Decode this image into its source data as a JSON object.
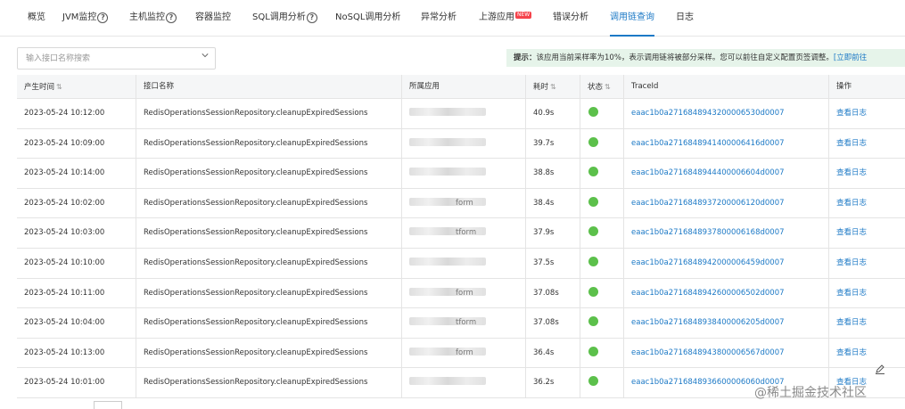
{
  "tabs": [
    {
      "label": "概览"
    },
    {
      "label": "JVM监控"
    },
    {
      "label": "主机监控"
    },
    {
      "label": "容器监控"
    },
    {
      "label": "SQL调用分析"
    },
    {
      "label": "NoSQL调用分析"
    },
    {
      "label": "异常分析"
    },
    {
      "label": "上游应用",
      "badge": "NEW"
    },
    {
      "label": "错误分析"
    },
    {
      "label": "调用链查询"
    },
    {
      "label": "日志"
    }
  ],
  "search": {
    "placeholder": "输入接口名称搜索",
    "value": ""
  },
  "notice": {
    "prefix": "提示：",
    "text": "该应用当前采样率为10%，表示调用链将被部分采样。您可以前往自定义配置页签调整。",
    "link": "[立即前往"
  },
  "table": {
    "columns": {
      "time": "产生时间",
      "api": "接口名称",
      "app": "所属应用",
      "duration": "耗时",
      "status": "状态",
      "trace": "TraceId",
      "op": "操作"
    },
    "rows": [
      {
        "time": "2023-05-24 10:12:00",
        "api": "RedisOperationsSessionRepository.cleanupExpiredSessions",
        "app_visible": "",
        "duration": "40.9s",
        "status": "ok",
        "trace": "eaac1b0a2716848943200006530d0007",
        "op": "查看日志"
      },
      {
        "time": "2023-05-24 10:09:00",
        "api": "RedisOperationsSessionRepository.cleanupExpiredSessions",
        "app_visible": "",
        "duration": "39.7s",
        "status": "ok",
        "trace": "eaac1b0a2716848941400006416d0007",
        "op": "查看日志"
      },
      {
        "time": "2023-05-24 10:14:00",
        "api": "RedisOperationsSessionRepository.cleanupExpiredSessions",
        "app_visible": "",
        "duration": "38.8s",
        "status": "ok",
        "trace": "eaac1b0a2716848944400006604d0007",
        "op": "查看日志"
      },
      {
        "time": "2023-05-24 10:02:00",
        "api": "RedisOperationsSessionRepository.cleanupExpiredSessions",
        "app_visible": "form",
        "duration": "38.4s",
        "status": "ok",
        "trace": "eaac1b0a2716848937200006120d0007",
        "op": "查看日志"
      },
      {
        "time": "2023-05-24 10:03:00",
        "api": "RedisOperationsSessionRepository.cleanupExpiredSessions",
        "app_visible": "tform",
        "duration": "37.9s",
        "status": "ok",
        "trace": "eaac1b0a2716848937800006168d0007",
        "op": "查看日志"
      },
      {
        "time": "2023-05-24 10:10:00",
        "api": "RedisOperationsSessionRepository.cleanupExpiredSessions",
        "app_visible": "",
        "duration": "37.5s",
        "status": "ok",
        "trace": "eaac1b0a2716848942000006459d0007",
        "op": "查看日志"
      },
      {
        "time": "2023-05-24 10:11:00",
        "api": "RedisOperationsSessionRepository.cleanupExpiredSessions",
        "app_visible": "form",
        "duration": "37.08s",
        "status": "ok",
        "trace": "eaac1b0a2716848942600006502d0007",
        "op": "查看日志"
      },
      {
        "time": "2023-05-24 10:04:00",
        "api": "RedisOperationsSessionRepository.cleanupExpiredSessions",
        "app_visible": "tform",
        "duration": "37.08s",
        "status": "ok",
        "trace": "eaac1b0a2716848938400006205d0007",
        "op": "查看日志"
      },
      {
        "time": "2023-05-24 10:13:00",
        "api": "RedisOperationsSessionRepository.cleanupExpiredSessions",
        "app_visible": "form",
        "duration": "36.4s",
        "status": "ok",
        "trace": "eaac1b0a2716848943800006567d0007",
        "op": "查看日志"
      },
      {
        "time": "2023-05-24 10:01:00",
        "api": "RedisOperationsSessionRepository.cleanupExpiredSessions",
        "app_visible": "",
        "duration": "36.2s",
        "status": "ok",
        "trace": "eaac1b0a2716848936600006060d0007",
        "op": "查看日志"
      }
    ]
  },
  "colors": {
    "accent": "#1c79c6",
    "status_ok": "#5cc04b",
    "notice_bg": "#e6f4ea",
    "badge": "#f5434b"
  },
  "watermark": "@稀土掘金技术社区"
}
